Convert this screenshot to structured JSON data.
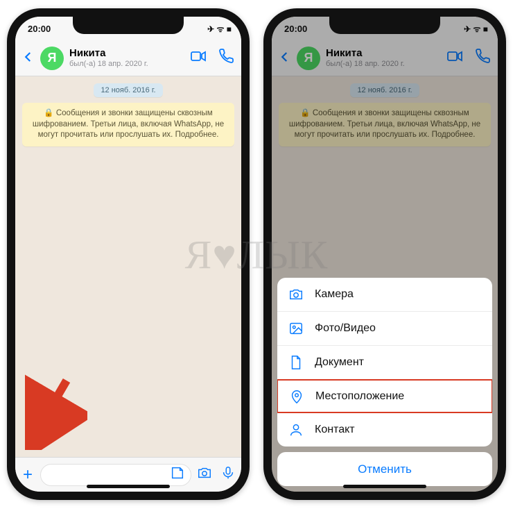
{
  "status": {
    "time": "20:00",
    "icons": "✈︎ ᯤ ■"
  },
  "header": {
    "avatar_letter": "Я",
    "name": "Никита",
    "last_seen": "был(-а) 18 апр. 2020 г."
  },
  "chat": {
    "date_badge": "12 нояб. 2016 г.",
    "encryption": "🔒 Сообщения и звонки защищены сквозным шифрованием. Третьи лица, включая WhatsApp, не могут прочитать или прослушать их. Подробнее."
  },
  "sheet": {
    "items": [
      {
        "label": "Камера"
      },
      {
        "label": "Фото/Видео"
      },
      {
        "label": "Документ"
      },
      {
        "label": "Местоположение"
      },
      {
        "label": "Контакт"
      }
    ],
    "cancel": "Отменить"
  },
  "watermark": "Я♥ЛЫК"
}
